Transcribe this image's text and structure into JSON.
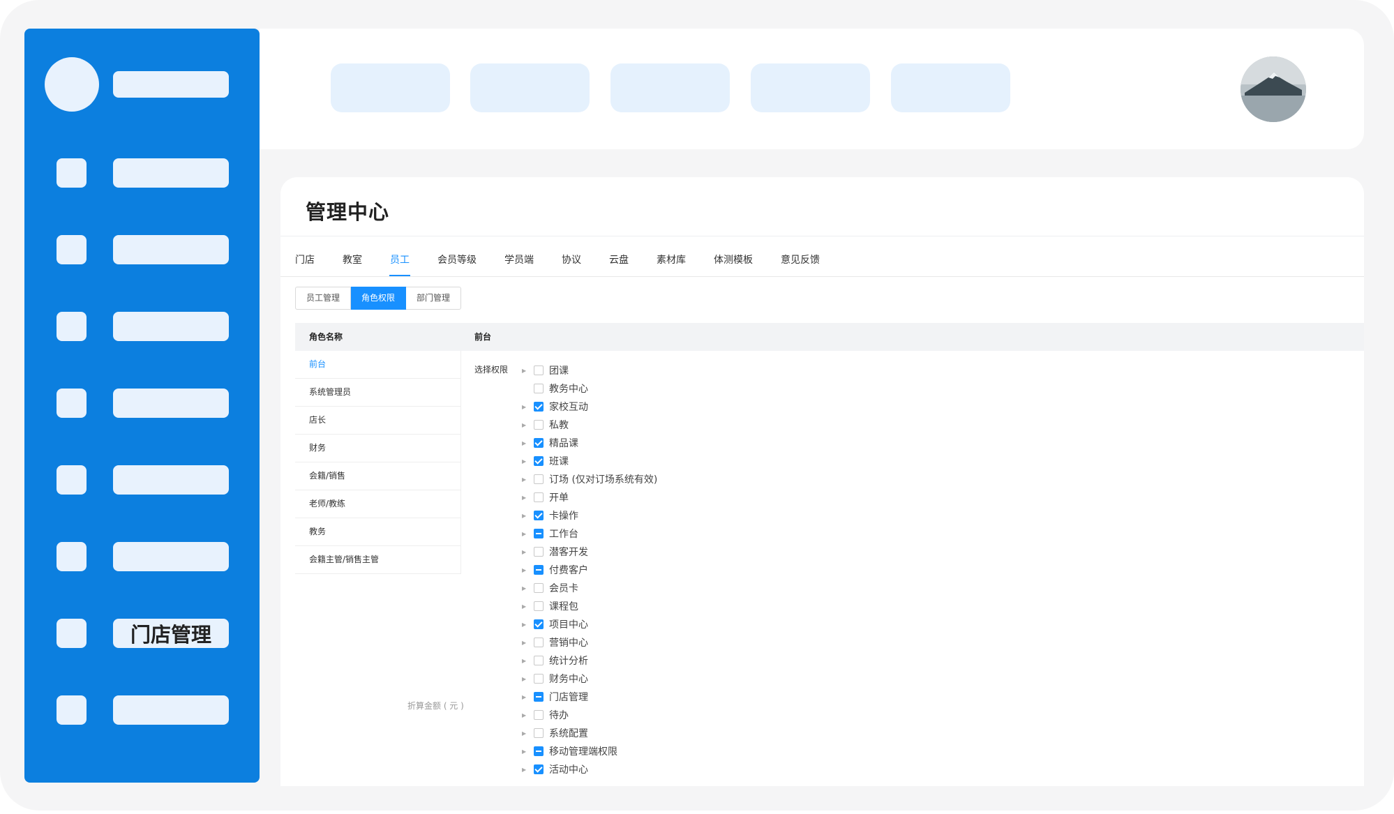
{
  "sidebar": {
    "store_management_label": "门店管理"
  },
  "main": {
    "title": "管理中心",
    "tabs": [
      {
        "label": "门店"
      },
      {
        "label": "教室"
      },
      {
        "label": "员工"
      },
      {
        "label": "会员等级"
      },
      {
        "label": "学员端"
      },
      {
        "label": "协议"
      },
      {
        "label": "云盘"
      },
      {
        "label": "素材库"
      },
      {
        "label": "体测模板"
      },
      {
        "label": "意见反馈"
      }
    ],
    "subtabs": [
      {
        "label": "员工管理"
      },
      {
        "label": "角色权限"
      },
      {
        "label": "部门管理"
      }
    ],
    "table": {
      "col_role": "角色名称",
      "col_selected": "前台"
    },
    "roles": [
      {
        "label": "前台"
      },
      {
        "label": "系统管理员"
      },
      {
        "label": "店长"
      },
      {
        "label": "财务"
      },
      {
        "label": "会籍/销售"
      },
      {
        "label": "老师/教练"
      },
      {
        "label": "教务"
      },
      {
        "label": "会籍主管/销售主管"
      }
    ],
    "discount_label": "折算金额 ( 元 )",
    "perm_label": "选择权限",
    "permissions": [
      {
        "label": "团课",
        "state": "unchecked",
        "expandable": true
      },
      {
        "label": "教务中心",
        "state": "unchecked",
        "expandable": false
      },
      {
        "label": "家校互动",
        "state": "checked",
        "expandable": true
      },
      {
        "label": "私教",
        "state": "unchecked",
        "expandable": true
      },
      {
        "label": "精品课",
        "state": "checked",
        "expandable": true
      },
      {
        "label": "班课",
        "state": "checked",
        "expandable": true
      },
      {
        "label": "订场 (仅对订场系统有效)",
        "state": "unchecked",
        "expandable": true
      },
      {
        "label": "开单",
        "state": "unchecked",
        "expandable": true
      },
      {
        "label": "卡操作",
        "state": "checked",
        "expandable": true
      },
      {
        "label": "工作台",
        "state": "partial",
        "expandable": true
      },
      {
        "label": "潜客开发",
        "state": "unchecked",
        "expandable": true
      },
      {
        "label": "付费客户",
        "state": "partial",
        "expandable": true
      },
      {
        "label": "会员卡",
        "state": "unchecked",
        "expandable": true
      },
      {
        "label": "课程包",
        "state": "unchecked",
        "expandable": true
      },
      {
        "label": "项目中心",
        "state": "checked",
        "expandable": true
      },
      {
        "label": "营销中心",
        "state": "unchecked",
        "expandable": true
      },
      {
        "label": "统计分析",
        "state": "unchecked",
        "expandable": true
      },
      {
        "label": "财务中心",
        "state": "unchecked",
        "expandable": true
      },
      {
        "label": "门店管理",
        "state": "partial",
        "expandable": true
      },
      {
        "label": "待办",
        "state": "unchecked",
        "expandable": true
      },
      {
        "label": "系统配置",
        "state": "unchecked",
        "expandable": true
      },
      {
        "label": "移动管理端权限",
        "state": "partial",
        "expandable": true
      },
      {
        "label": "活动中心",
        "state": "checked",
        "expandable": true
      }
    ]
  },
  "colors": {
    "sidebar_bg": "#0c7fdf",
    "accent": "#1890ff",
    "placeholder": "#e8f2fd"
  }
}
